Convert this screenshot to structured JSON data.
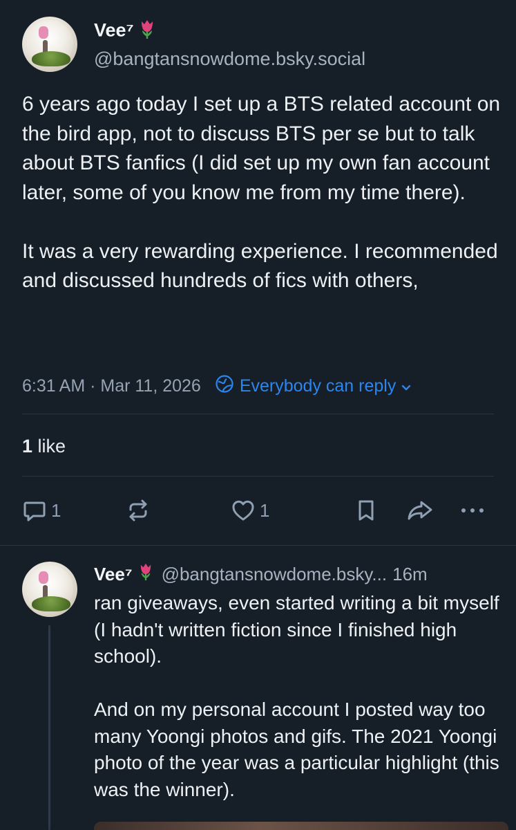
{
  "post": {
    "display_name": "Vee⁷",
    "emoji": "tulip",
    "handle": "@bangtansnowdome.bsky.social",
    "paragraphs": [
      "6 years ago today I set up a BTS related account on the bird app, not to discuss BTS per se but to talk about BTS fanfics (I did set up my own fan account later, some of you know me from my time there).",
      "It was a very rewarding experience. I recommended and discussed hundreds of fics with others,"
    ],
    "timestamp": "6:31 AM · Mar 11, 2026",
    "reply_setting": "Everybody can reply",
    "likes_count": "1",
    "likes_label": "like",
    "actions": {
      "reply_count": "1",
      "like_count": "1"
    }
  },
  "reply": {
    "display_name": "Vee⁷",
    "emoji": "tulip",
    "handle": "@bangtansnowdome.bsky...",
    "time": "16m",
    "paragraphs": [
      "ran giveaways, even started writing a bit myself (I hadn't written fiction since I finished high school).",
      "And on my personal account I posted way too many Yoongi photos and gifs. The 2021 Yoongi photo of the year was a particular highlight (this was the winner)."
    ]
  },
  "colors": {
    "background": "#161e27",
    "accent_blue": "#2b86f0",
    "muted": "#95a3b2",
    "tulip_pink": "#e0437c"
  },
  "icons": [
    "tulip-icon",
    "globe-icon",
    "chevron-down-icon",
    "reply-icon",
    "repost-icon",
    "heart-icon",
    "bookmark-icon",
    "share-icon",
    "more-icon"
  ]
}
